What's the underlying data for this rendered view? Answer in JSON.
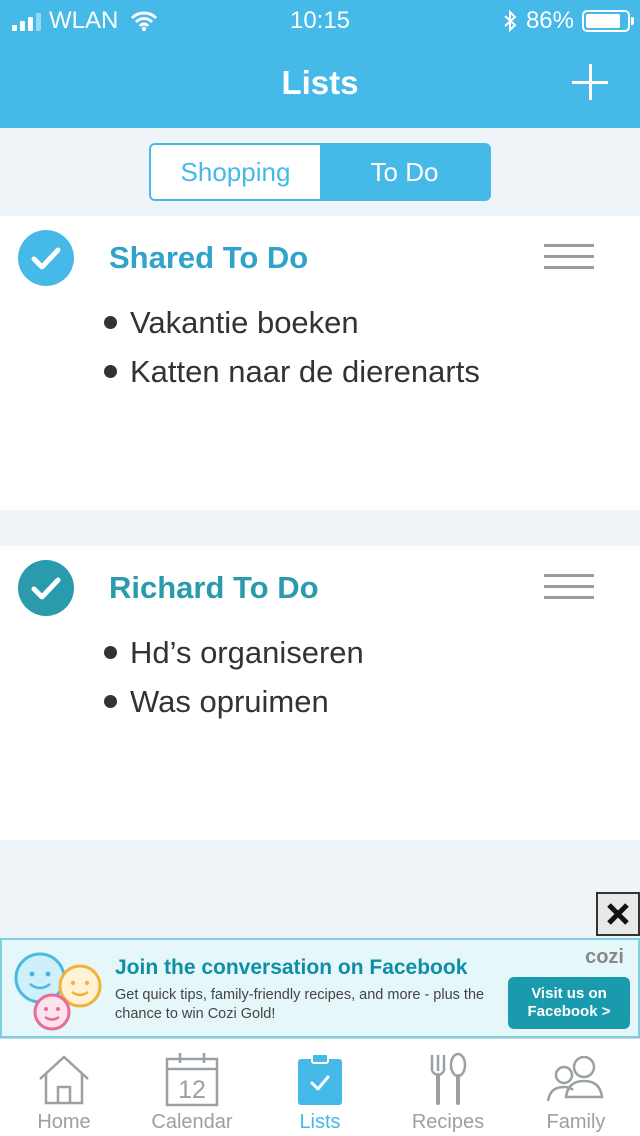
{
  "status_bar": {
    "carrier": "WLAN",
    "time": "10:15",
    "battery": "86%",
    "battery_level": 0.86
  },
  "nav": {
    "title": "Lists",
    "add_icon": "plus-icon"
  },
  "segments": [
    {
      "label": "Shopping",
      "active": false
    },
    {
      "label": "To Do",
      "active": true
    }
  ],
  "lists": [
    {
      "title": "Shared To Do",
      "color": "#2fa3cc",
      "items": [
        "Vakantie boeken",
        "Katten naar de dierenarts"
      ]
    },
    {
      "title": "Richard To Do",
      "color": "#2a9aad",
      "items": [
        "Hd’s organiseren",
        "Was opruimen"
      ]
    }
  ],
  "ad": {
    "headline": "Join the conversation on Facebook",
    "body": "Get quick tips, family-friendly recipes, and more - plus the chance to win Cozi Gold!",
    "logo": "cozi",
    "cta": "Visit us on Facebook >"
  },
  "tabs": [
    {
      "label": "Home",
      "icon": "home-icon",
      "active": false
    },
    {
      "label": "Calendar",
      "icon": "calendar-icon",
      "active": false,
      "day": "12"
    },
    {
      "label": "Lists",
      "icon": "clipboard-check-icon",
      "active": true
    },
    {
      "label": "Recipes",
      "icon": "fork-spoon-icon",
      "active": false
    },
    {
      "label": "Family",
      "icon": "people-icon",
      "active": false
    }
  ],
  "colors": {
    "accent": "#45b9e7",
    "background": "#eef4f7",
    "ad_button": "#1a9bad"
  }
}
